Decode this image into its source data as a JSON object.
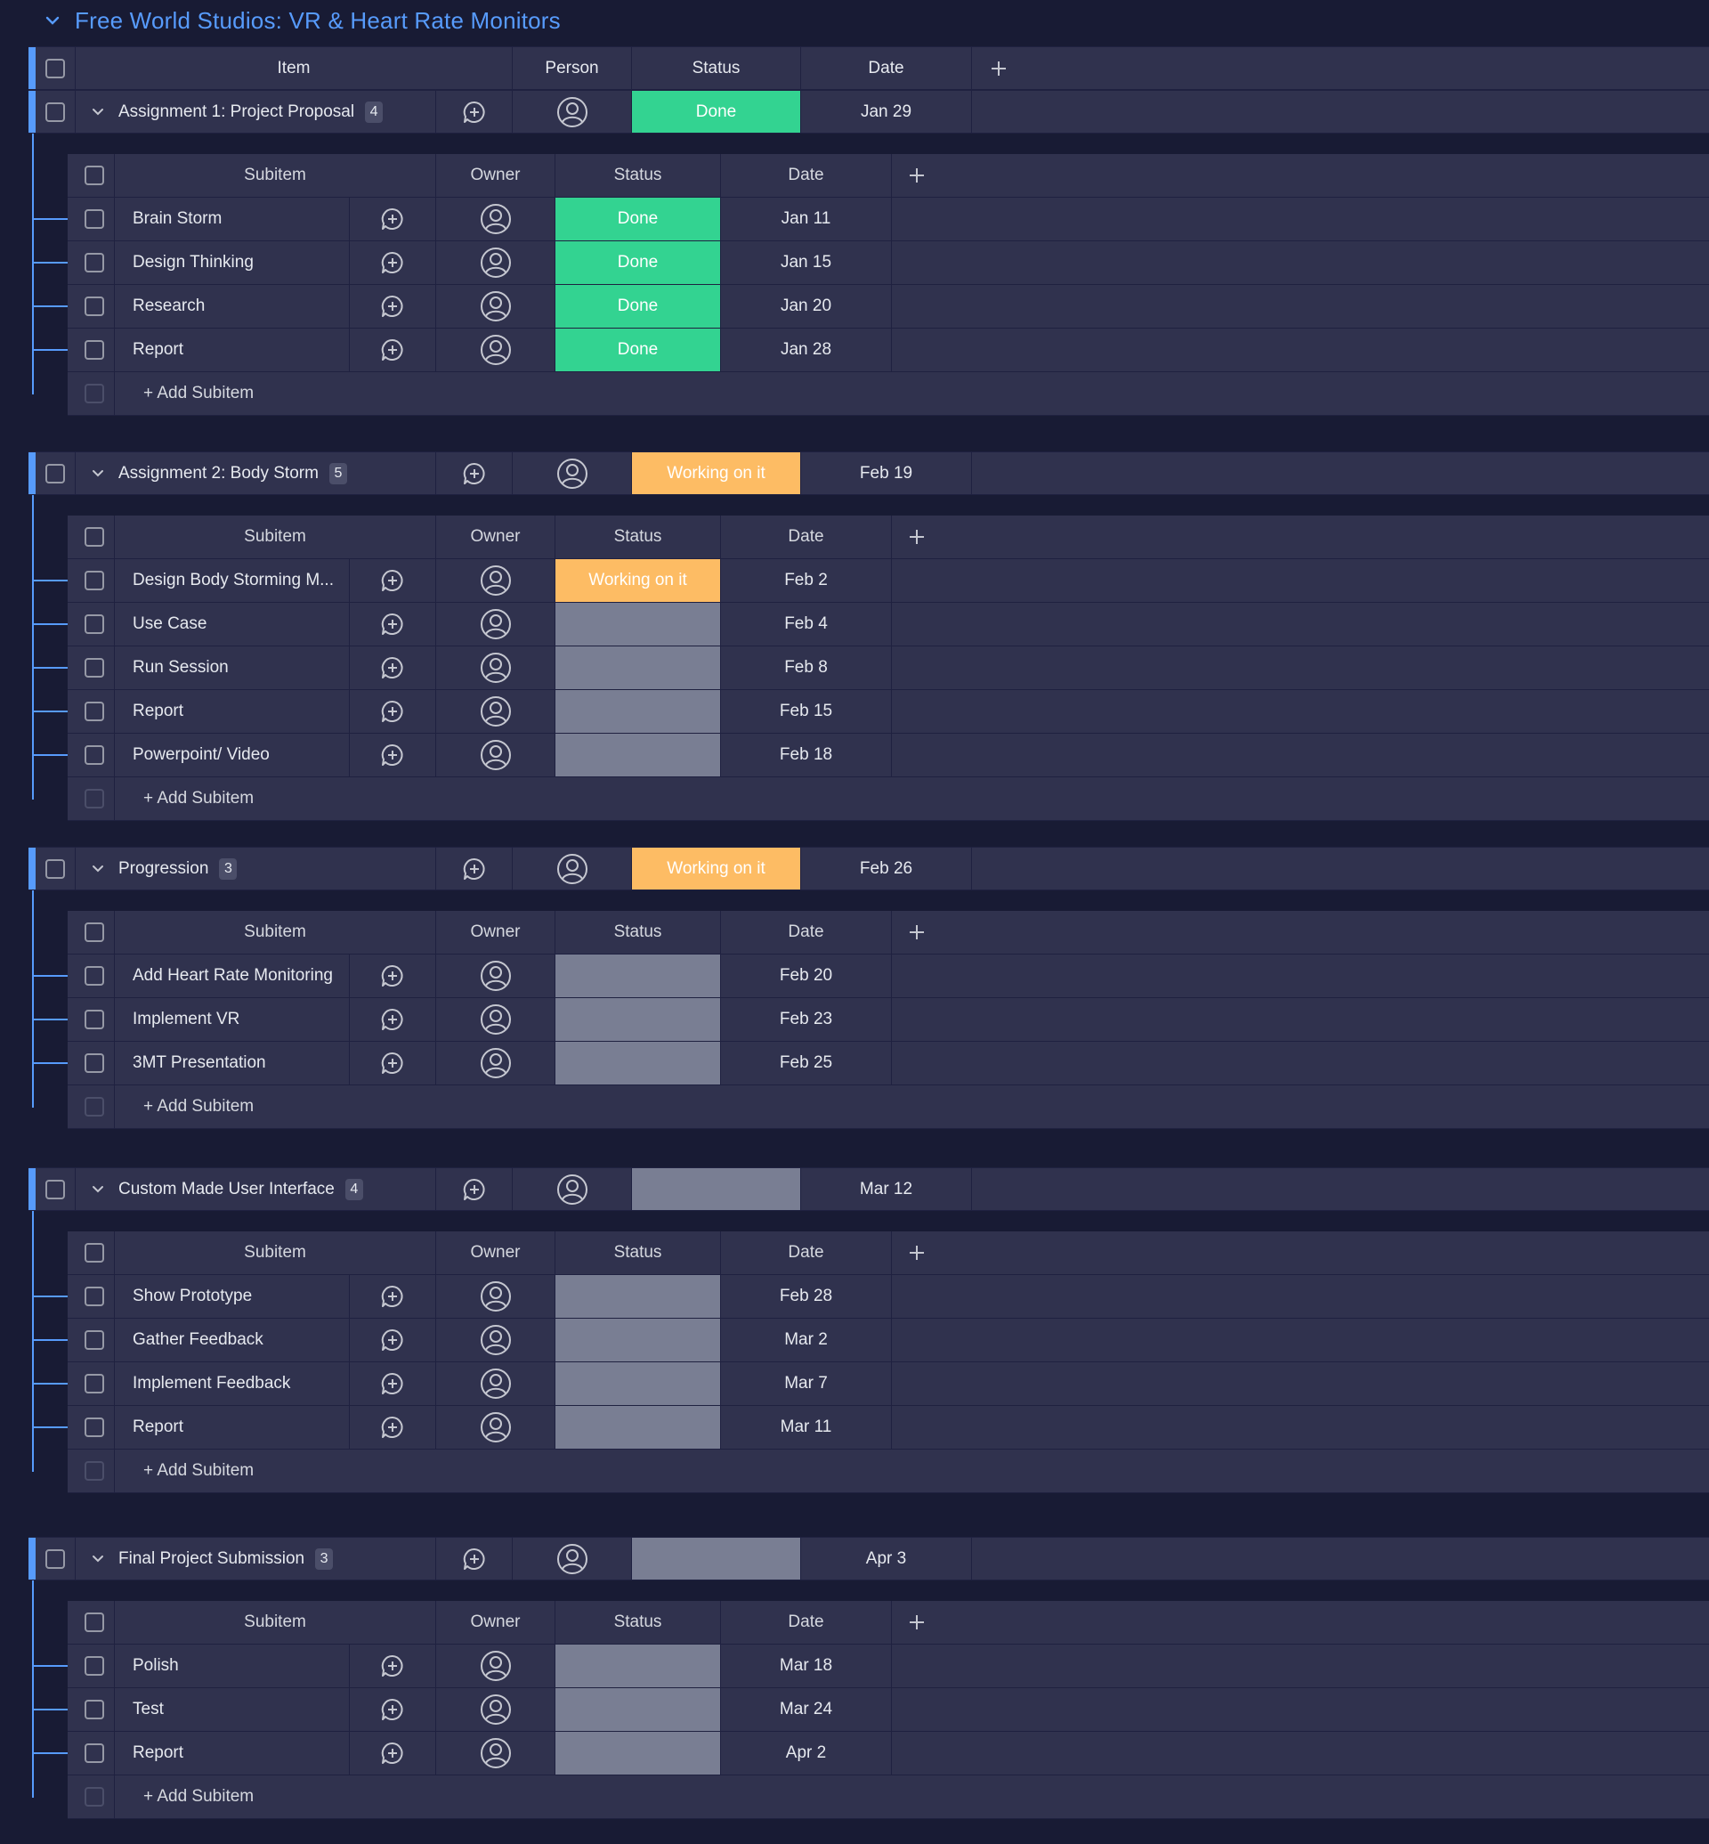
{
  "board": {
    "title": "Free World Studios: VR & Heart Rate Monitors"
  },
  "columns": {
    "item": "Item",
    "person": "Person",
    "status": "Status",
    "date": "Date"
  },
  "sub_columns": {
    "subitem": "Subitem",
    "owner": "Owner",
    "status": "Status",
    "date": "Date"
  },
  "add_subitem_label": "+ Add Subitem",
  "colors": {
    "accent": "#579bfc",
    "done": "#33d391",
    "working": "#fdbc64",
    "empty": "#797e93",
    "row": "#30324e",
    "background": "#181b34"
  },
  "groups": [
    {
      "name": "Assignment 1: Project Proposal",
      "count": "4",
      "status": "Done",
      "status_type": "done",
      "date": "Jan 29",
      "subitems": [
        {
          "name": "Brain Storm",
          "status": "Done",
          "status_type": "done",
          "date": "Jan 11"
        },
        {
          "name": "Design Thinking",
          "status": "Done",
          "status_type": "done",
          "date": "Jan 15"
        },
        {
          "name": "Research",
          "status": "Done",
          "status_type": "done",
          "date": "Jan 20"
        },
        {
          "name": "Report",
          "status": "Done",
          "status_type": "done",
          "date": "Jan 28"
        }
      ]
    },
    {
      "name": "Assignment 2: Body Storm",
      "count": "5",
      "status": "Working on it",
      "status_type": "working",
      "date": "Feb 19",
      "subitems": [
        {
          "name": "Design Body Storming M...",
          "status": "Working on it",
          "status_type": "working",
          "date": "Feb 2"
        },
        {
          "name": "Use Case",
          "status": "",
          "status_type": "empty",
          "date": "Feb 4"
        },
        {
          "name": "Run Session",
          "status": "",
          "status_type": "empty",
          "date": "Feb 8"
        },
        {
          "name": "Report",
          "status": "",
          "status_type": "empty",
          "date": "Feb 15"
        },
        {
          "name": "Powerpoint/ Video",
          "status": "",
          "status_type": "empty",
          "date": "Feb 18"
        }
      ]
    },
    {
      "name": "Progression",
      "count": "3",
      "status": "Working on it",
      "status_type": "working",
      "date": "Feb 26",
      "subitems": [
        {
          "name": "Add Heart Rate Monitoring",
          "status": "",
          "status_type": "empty",
          "date": "Feb 20"
        },
        {
          "name": "Implement VR",
          "status": "",
          "status_type": "empty",
          "date": "Feb 23"
        },
        {
          "name": "3MT Presentation",
          "status": "",
          "status_type": "empty",
          "date": "Feb 25"
        }
      ]
    },
    {
      "name": "Custom Made User Interface",
      "count": "4",
      "status": "",
      "status_type": "empty",
      "date": "Mar 12",
      "subitems": [
        {
          "name": "Show Prototype",
          "status": "",
          "status_type": "empty",
          "date": "Feb 28"
        },
        {
          "name": "Gather Feedback",
          "status": "",
          "status_type": "empty",
          "date": "Mar 2"
        },
        {
          "name": "Implement Feedback",
          "status": "",
          "status_type": "empty",
          "date": "Mar 7"
        },
        {
          "name": "Report",
          "status": "",
          "status_type": "empty",
          "date": "Mar 11"
        }
      ]
    },
    {
      "name": "Final Project Submission",
      "count": "3",
      "status": "",
      "status_type": "empty",
      "date": "Apr 3",
      "subitems": [
        {
          "name": "Polish",
          "status": "",
          "status_type": "empty",
          "date": "Mar 18"
        },
        {
          "name": "Test",
          "status": "",
          "status_type": "empty",
          "date": "Mar 24"
        },
        {
          "name": "Report",
          "status": "",
          "status_type": "empty",
          "date": "Apr 2"
        }
      ]
    }
  ]
}
